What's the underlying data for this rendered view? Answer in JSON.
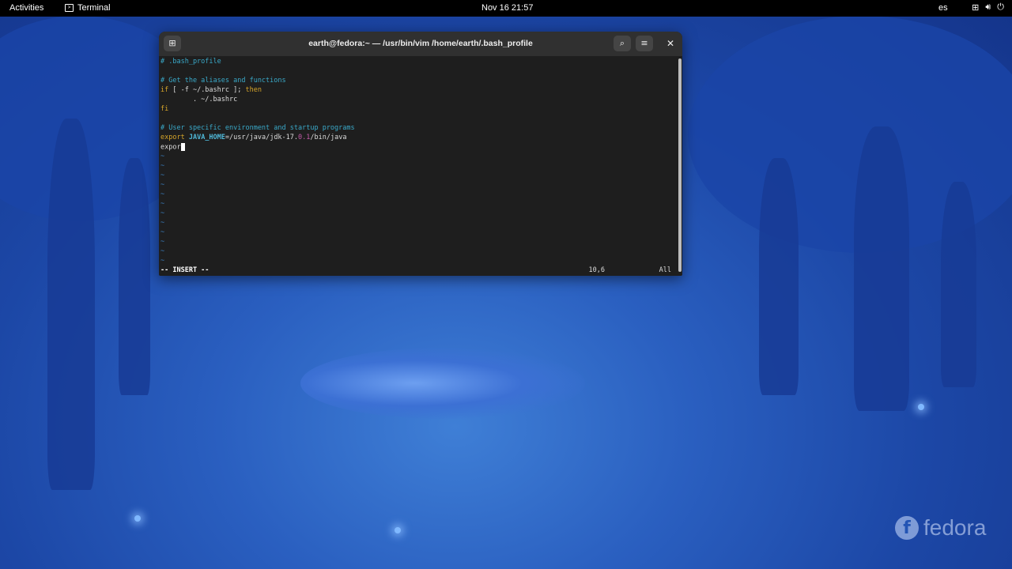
{
  "topbar": {
    "activities": "Activities",
    "app_name": "Terminal",
    "clock": "Nov 16  21:57",
    "language": "es",
    "icons": [
      "network-icon",
      "volume-icon",
      "power-icon"
    ]
  },
  "window": {
    "title": "earth@fedora:~ — /usr/bin/vim /home/earth/.bash_profile",
    "buttons": {
      "search": "search-icon",
      "menu": "menu-icon",
      "close": "close-icon",
      "new_tab": "new-tab-icon"
    }
  },
  "editor": {
    "lines": {
      "l1": "# .bash_profile",
      "l3": "# Get the aliases and functions",
      "l4_kw1": "if",
      "l4_mid": " [ -f ~/.bashrc ]; ",
      "l4_kw2": "then",
      "l5": "        . ~/.bashrc",
      "l6": "fi",
      "l8": "# User specific environment and startup programs",
      "l9_kw": "export",
      "l9_var": "JAVA_HOME",
      "l9_a": "=/usr/java/jdk-17.",
      "l9_num": "0.1",
      "l9_b": "/bin/java",
      "l10": "expor"
    },
    "tilde": "~",
    "status_mode": "-- INSERT --",
    "status_position": "10,6",
    "status_scroll": "All"
  },
  "wallpaper": {
    "logo_text": "fedora",
    "logo_mark": "f"
  },
  "colors": {
    "accent_comment": "#3aa9c9",
    "keyword": "#d6a52a",
    "wallpaper_base": "#1c47a6"
  }
}
